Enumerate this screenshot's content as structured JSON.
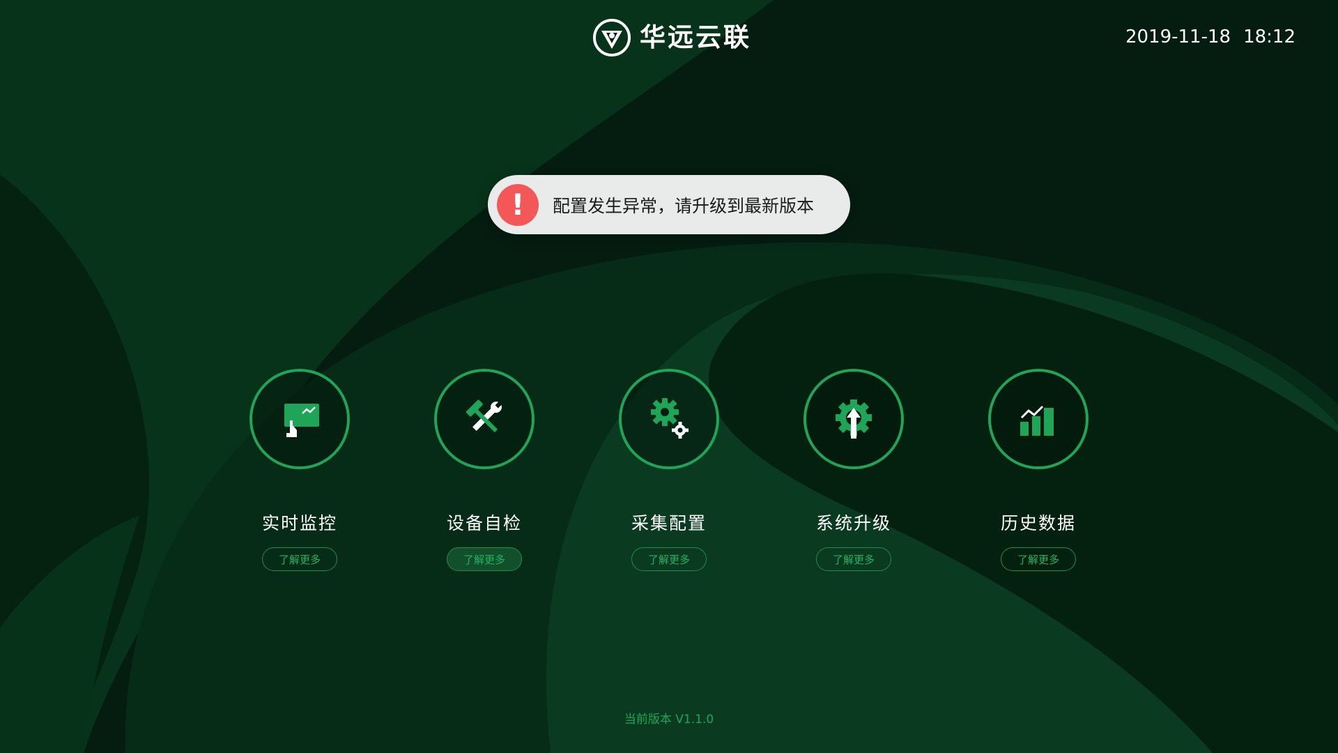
{
  "header": {
    "brand_name": "华远云联",
    "logo_icon": "brand-v-shield-icon",
    "date": "2019-11-18",
    "time": "18:12"
  },
  "alert": {
    "icon": "exclamation-icon",
    "symbol": "!",
    "message": "配置发生异常，请升级到最新版本",
    "color": "#f35757"
  },
  "features": [
    {
      "title": "实时监控",
      "icon": "monitor-touch-icon",
      "button_label": "了解更多"
    },
    {
      "title": "设备自检",
      "icon": "tools-wrench-hammer-icon",
      "button_label": "了解更多"
    },
    {
      "title": "采集配置",
      "icon": "gears-icon",
      "button_label": "了解更多"
    },
    {
      "title": "系统升级",
      "icon": "gear-upgrade-arrow-icon",
      "button_label": "了解更多"
    },
    {
      "title": "历史数据",
      "icon": "bar-chart-trend-icon",
      "button_label": "了解更多"
    }
  ],
  "footer": {
    "version_text": "当前版本 V1.1.0"
  },
  "colors": {
    "accent": "#1fa557",
    "background": "#041d10",
    "alert_bg": "#e8ebea"
  }
}
